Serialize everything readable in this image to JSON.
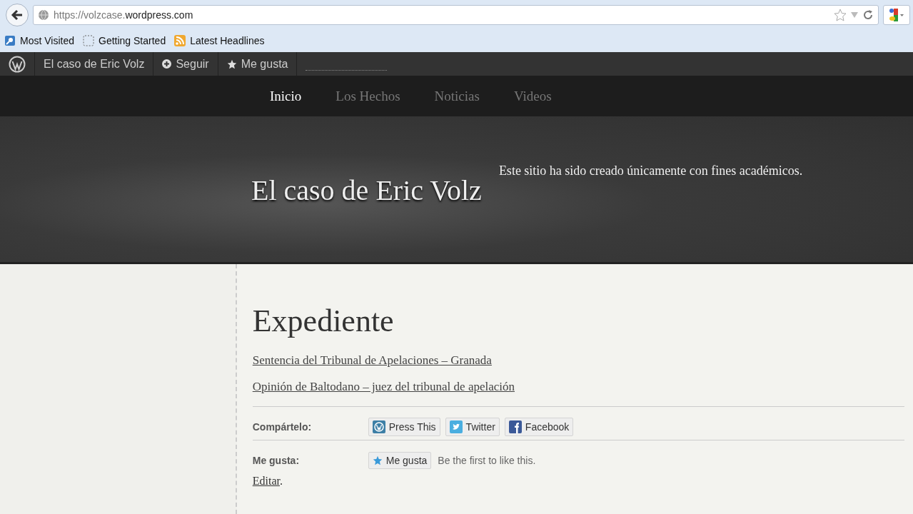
{
  "browser": {
    "url_prefix": "https://volzcase.",
    "url_domain": "wordpress.com",
    "bookmarks": [
      {
        "kind": "blue",
        "label": "Most Visited"
      },
      {
        "kind": "dashed",
        "label": "Getting Started"
      },
      {
        "kind": "rss",
        "label": "Latest Headlines"
      }
    ]
  },
  "admin_bar": {
    "site": "El caso de Eric Volz",
    "follow": "Seguir",
    "like": "Me gusta"
  },
  "nav": [
    {
      "label": "Inicio",
      "selected": true
    },
    {
      "label": "Los Hechos",
      "selected": false
    },
    {
      "label": "Noticias",
      "selected": false
    },
    {
      "label": "Videos",
      "selected": false
    }
  ],
  "header": {
    "title": "El caso de Eric Volz",
    "description": "Este sitio ha sido creado únicamente con fines académicos."
  },
  "post": {
    "title": "Expediente",
    "links": [
      "Sentencia del Tribunal de Apelaciones – Granada",
      "Opinión de Baltodano – juez del tribunal de apelación"
    ],
    "share_label": "Compártelo:",
    "share_buttons": [
      {
        "kind": "wordpress",
        "label": "Press This"
      },
      {
        "kind": "twitter",
        "label": "Twitter"
      },
      {
        "kind": "facebook",
        "label": "Facebook"
      }
    ],
    "like_label": "Me gusta:",
    "like_button": "Me gusta",
    "like_note": "Be the first to like this.",
    "edit_link": "Editar",
    "edit_suffix": "."
  }
}
